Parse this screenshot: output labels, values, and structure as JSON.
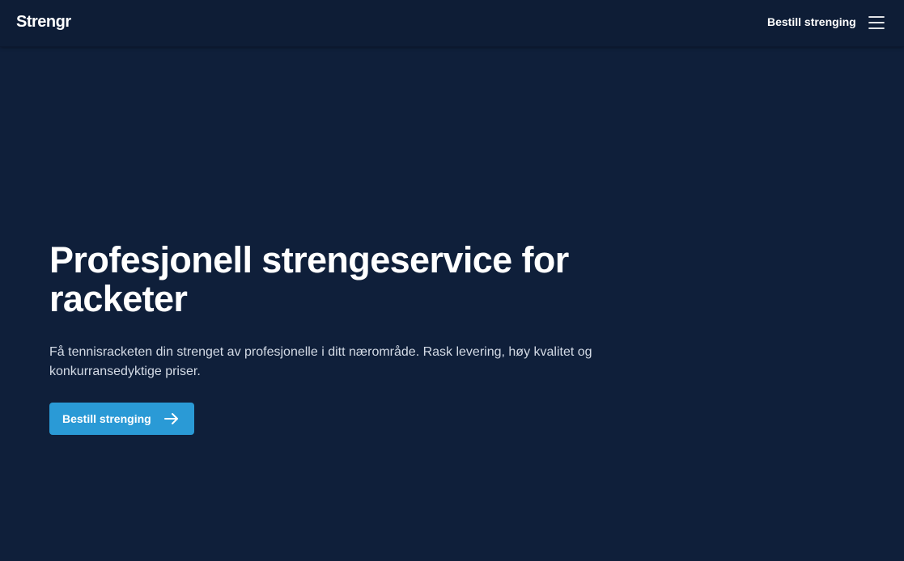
{
  "header": {
    "logo": "Strengr",
    "cta_label": "Bestill strenging",
    "menu_icon": "hamburger-menu-icon"
  },
  "hero": {
    "title": "Profesjonell strengeservice for racketer",
    "subtitle": "Få tennisracketen din strenget av profesjonelle i ditt nærområde. Rask levering, høy kvalitet og konkurransedyktige priser.",
    "cta_label": "Bestill strenging",
    "cta_icon": "arrow-right-icon"
  },
  "colors": {
    "background": "#0f1f3a",
    "accent": "#2a9ad6",
    "text": "#ffffff",
    "muted_text": "#d4dbe6"
  }
}
